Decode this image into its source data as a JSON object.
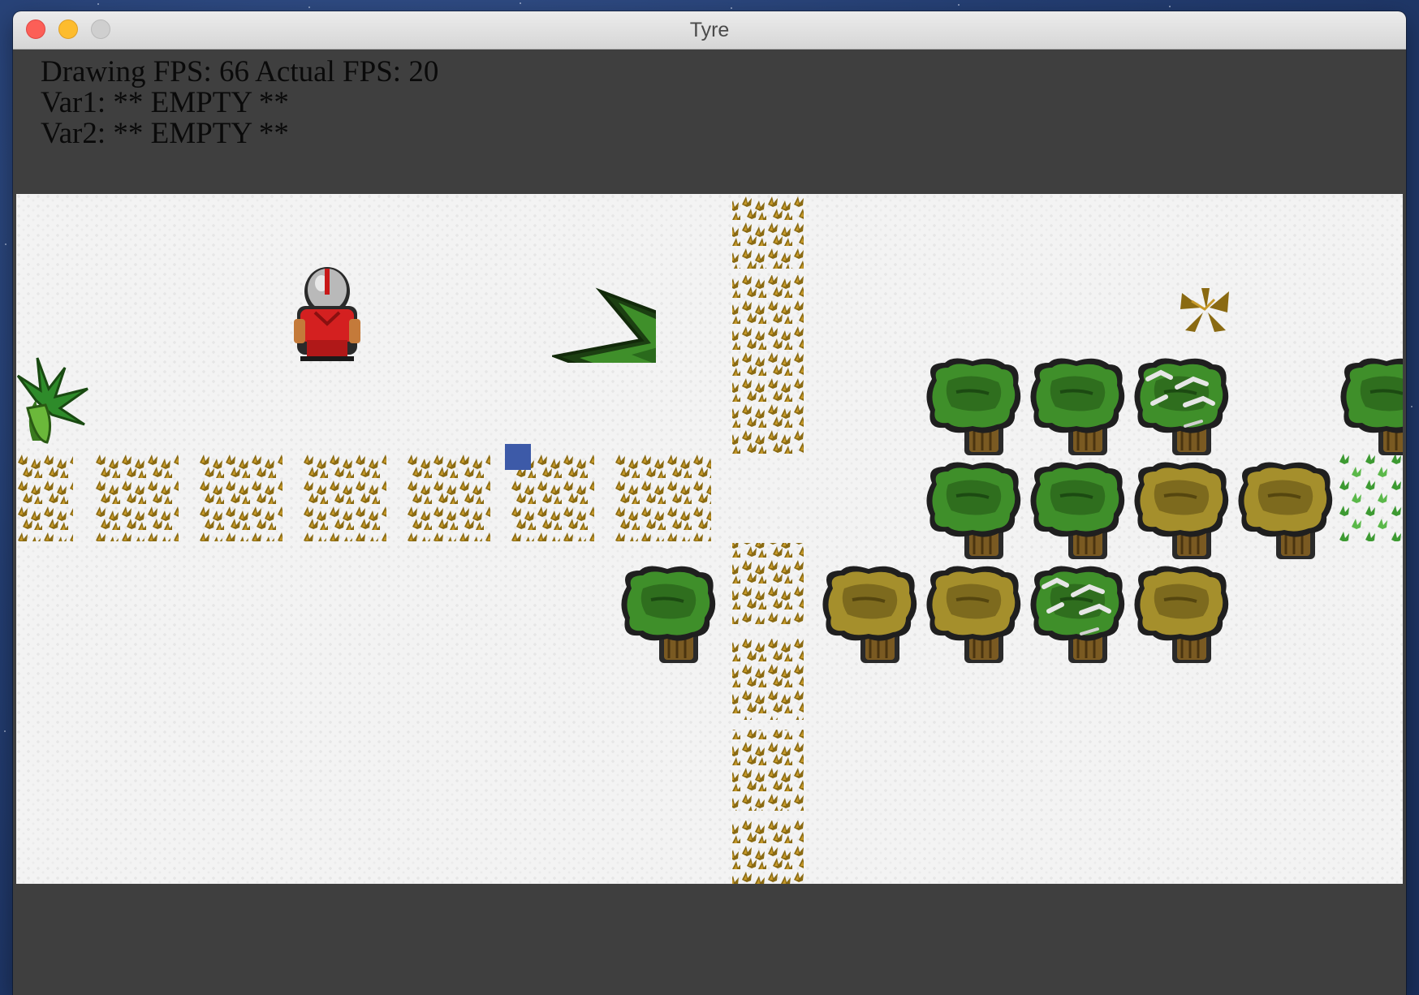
{
  "window": {
    "title": "Tyre"
  },
  "hud": {
    "fps_line": "Drawing FPS: 66 Actual FPS: 20",
    "var1_line": "Var1: ** EMPTY **",
    "var2_line": "Var2: ** EMPTY **"
  },
  "colors": {
    "hud_bg": "#3f3f3f",
    "snow": "#f3f3f3",
    "dry_grass": "#8a6a12",
    "green_bush": "#3f8f2a",
    "dry_bush": "#9a8a2a",
    "player_armor": "#d42020",
    "cursor": "#3d5aa8"
  },
  "icons": {
    "close": "close-icon",
    "minimize": "minimize-icon",
    "maximize": "maximize-icon"
  }
}
